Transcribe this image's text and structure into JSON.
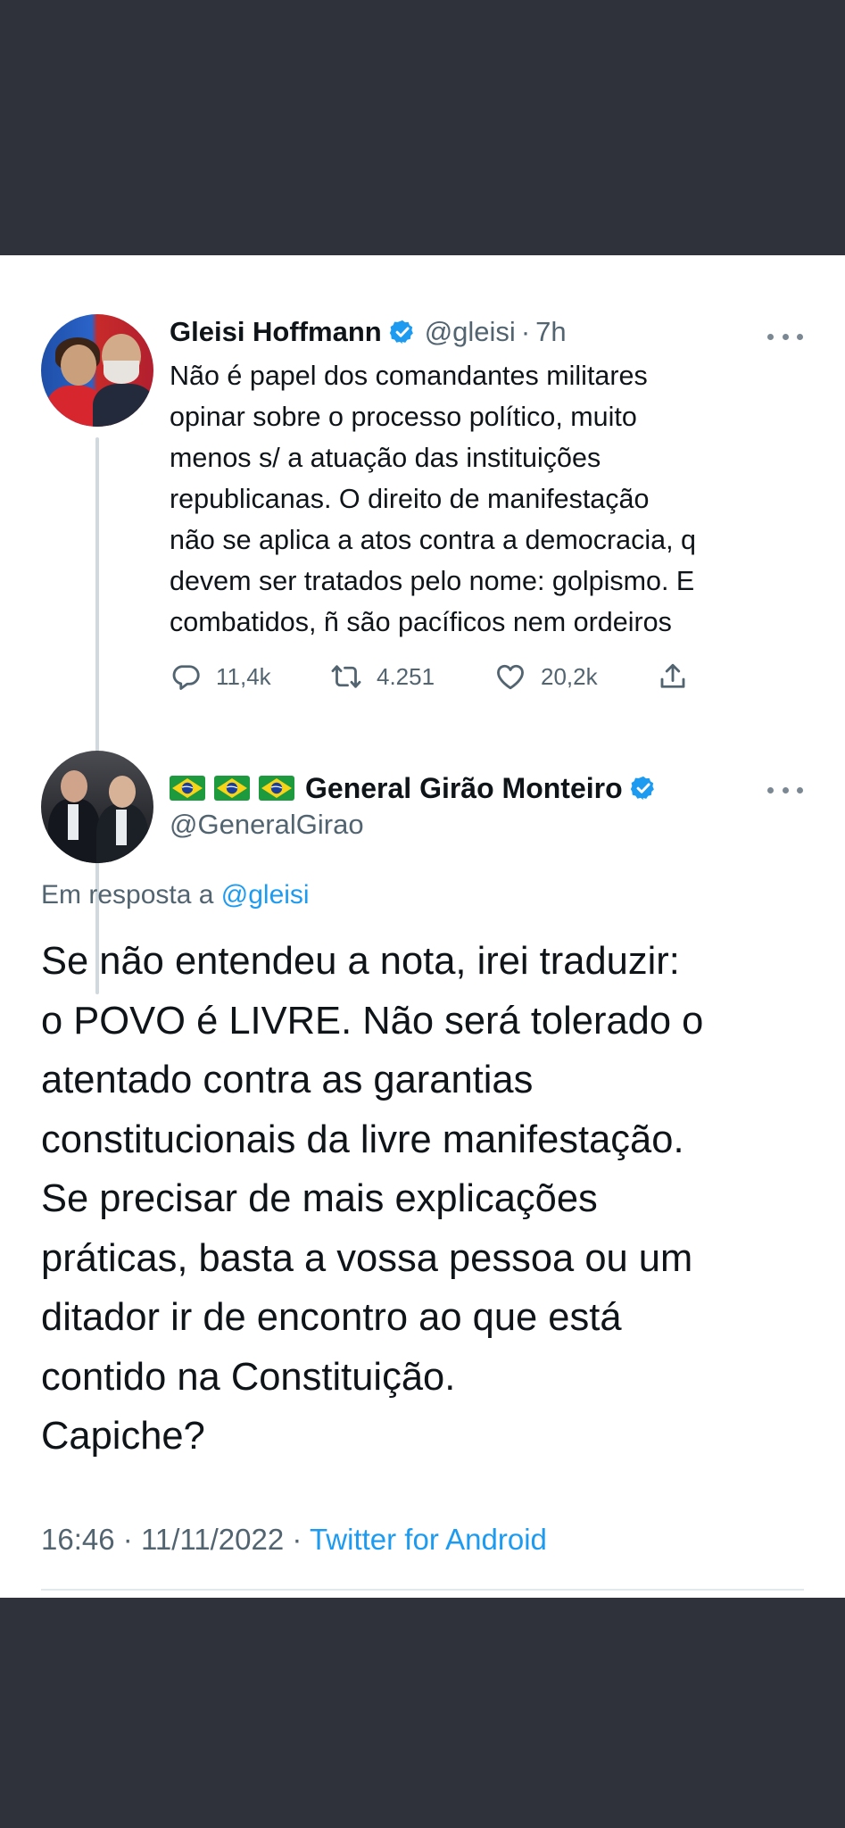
{
  "parent_tweet": {
    "author_name": "Gleisi Hoffmann",
    "handle": "@gleisi",
    "separator": "·",
    "time": "7h",
    "text": "Não é papel dos comandantes militares\nopinar sobre o processo político, muito\nmenos s/ a atuação das instituições\nrepublicanas. O direito de manifestação\nnão se aplica a atos contra a democracia, q\ndevem ser tratados pelo nome: golpismo. E\ncombatidos, ñ são pacíficos nem ordeiros",
    "replies": "11,4k",
    "retweets": "4.251",
    "likes": "20,2k"
  },
  "reply_tweet": {
    "author_name": "General Girão Monteiro",
    "flags": [
      "🇧🇷",
      "🇧🇷",
      "🇧🇷"
    ],
    "handle": "@GeneralGirao",
    "reply_prefix": "Em resposta a",
    "reply_mention": "@gleisi",
    "text": "Se não entendeu a nota, irei traduzir:\no POVO é LIVRE. Não será tolerado o\natentado contra as garantias\nconstitucionais da livre manifestação.\nSe precisar de mais explicações\npráticas, basta a vossa pessoa ou um\nditador ir de encontro ao que está\ncontido na Constituição.\nCapiche?",
    "time": "16:46",
    "date": "11/11/2022",
    "separator": "·",
    "source": "Twitter for Android"
  },
  "colors": {
    "text_primary": "#0f1419",
    "text_secondary": "#536471",
    "link": "#1d9bf0",
    "verified": "#1d9bf0",
    "background_dark": "#2f323a"
  },
  "icons": [
    "verified-badge-icon",
    "more-options-icon",
    "reply-icon",
    "retweet-icon",
    "like-icon",
    "share-icon",
    "brazil-flag-icon"
  ]
}
